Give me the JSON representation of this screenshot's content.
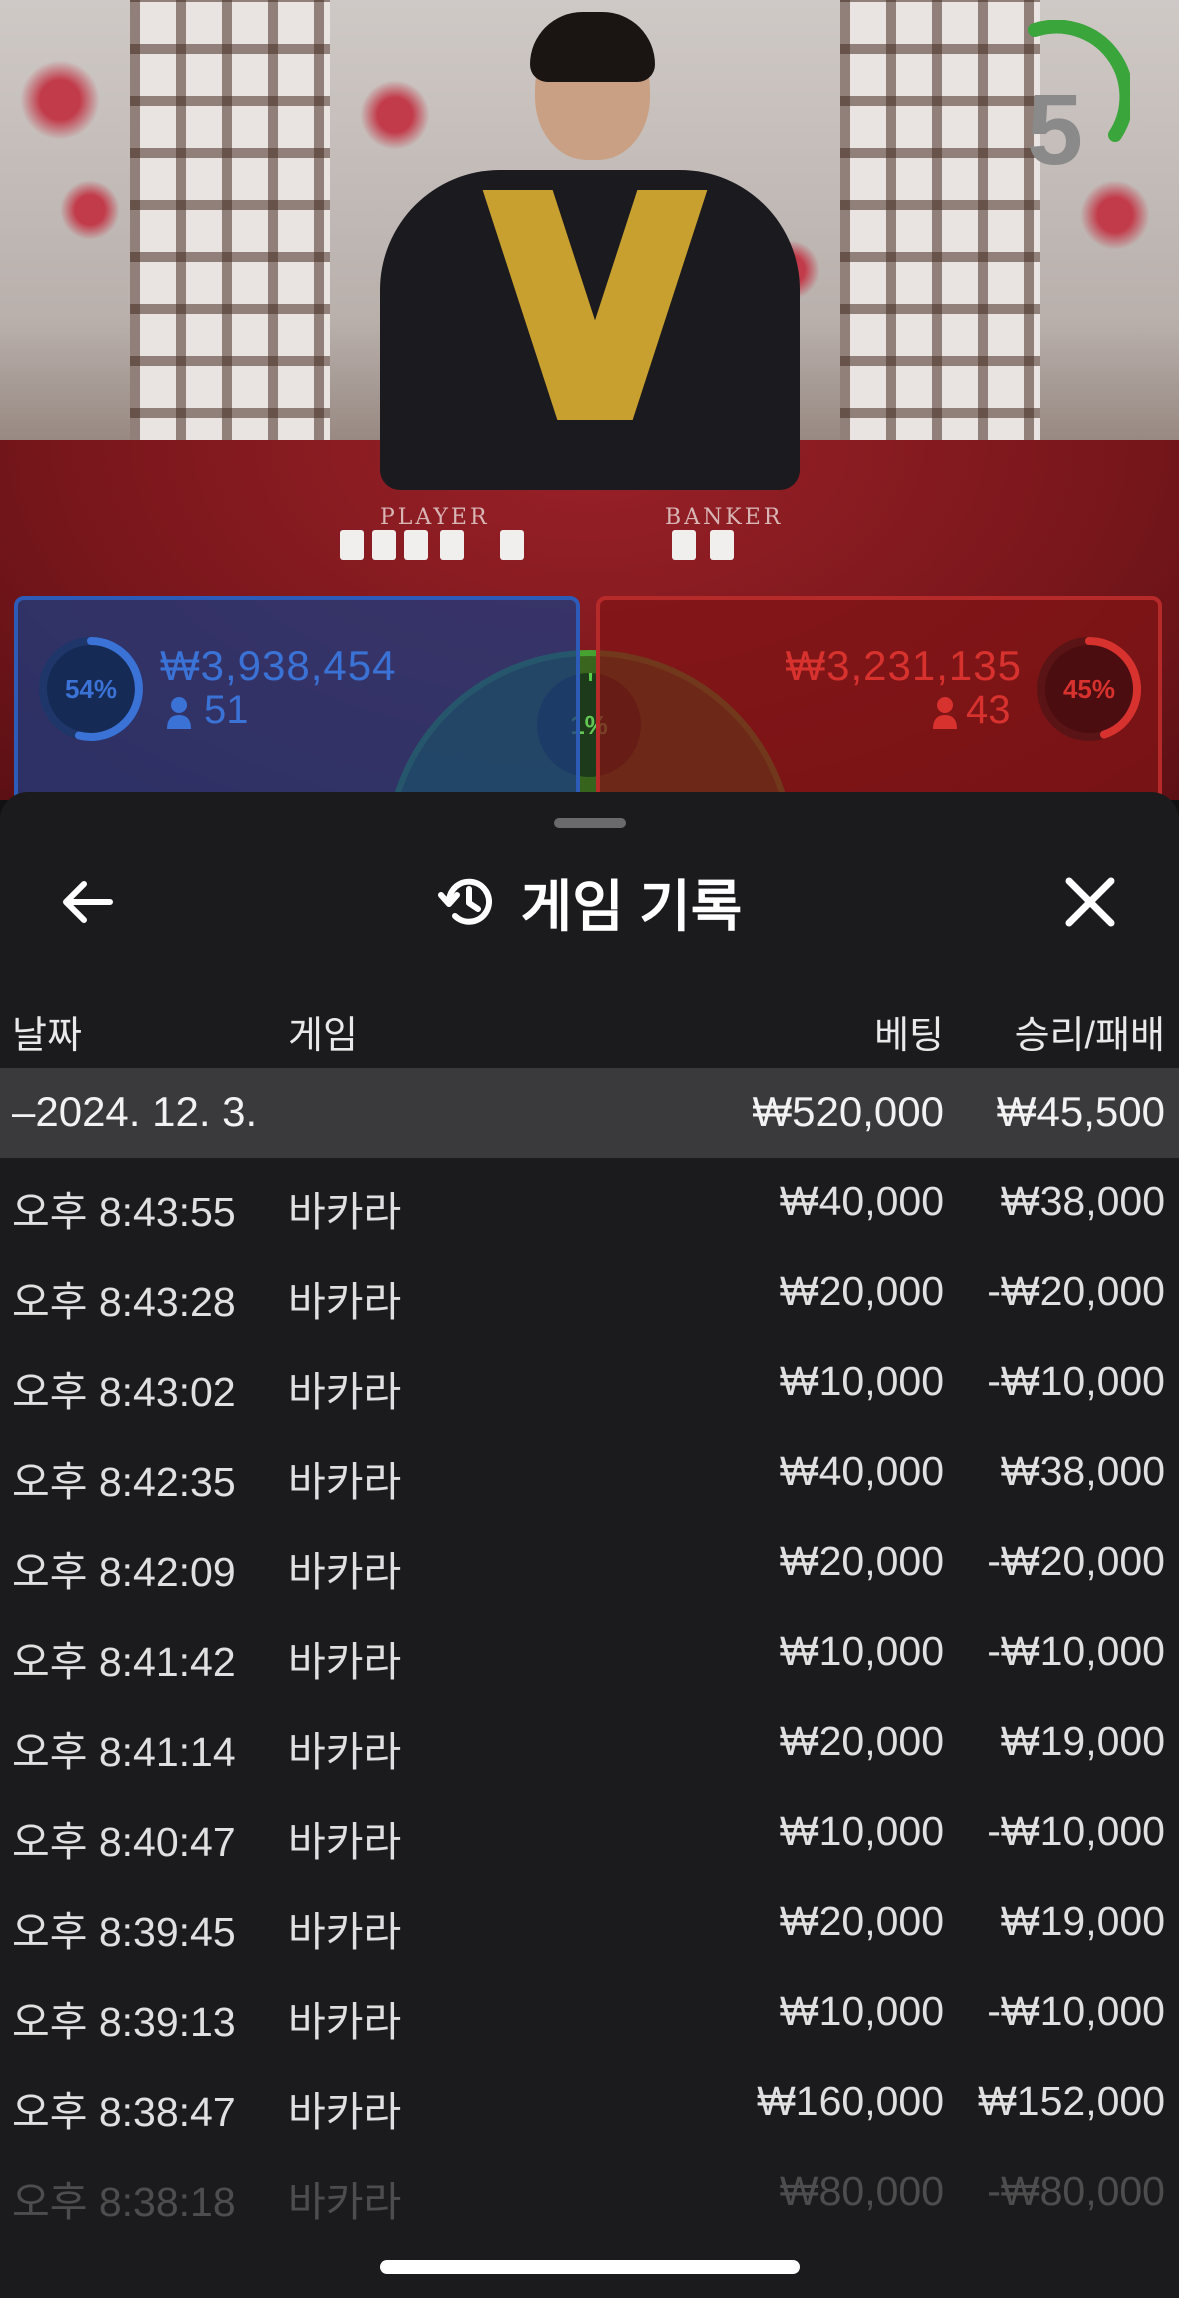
{
  "video": {
    "countdown": "5",
    "felt_labels": {
      "player": "PLAYER",
      "banker": "BANKER"
    }
  },
  "betting": {
    "player": {
      "percent": "54%",
      "amount": "₩3,938,454",
      "players": "51",
      "color": "#2d5bb8"
    },
    "tie": {
      "percent": "1%",
      "color": "#46a332"
    },
    "banker": {
      "percent": "45%",
      "amount": "₩3,231,135",
      "players": "43",
      "color": "#b72a2a"
    }
  },
  "sheet": {
    "title": "게임 기록",
    "back_icon": "arrow-left-icon",
    "history_icon": "history-icon",
    "close_icon": "close-icon",
    "columns": {
      "date": "날짜",
      "game": "게임",
      "bet": "베팅",
      "result": "승리/패배"
    },
    "group": {
      "date": "–2024. 12. 3.",
      "bet": "₩520,000",
      "result": "₩45,500"
    },
    "rows": [
      {
        "time": "오후 8:43:55",
        "game": "바카라",
        "bet": "₩40,000",
        "result": "₩38,000"
      },
      {
        "time": "오후 8:43:28",
        "game": "바카라",
        "bet": "₩20,000",
        "result": "-₩20,000"
      },
      {
        "time": "오후 8:43:02",
        "game": "바카라",
        "bet": "₩10,000",
        "result": "-₩10,000"
      },
      {
        "time": "오후 8:42:35",
        "game": "바카라",
        "bet": "₩40,000",
        "result": "₩38,000"
      },
      {
        "time": "오후 8:42:09",
        "game": "바카라",
        "bet": "₩20,000",
        "result": "-₩20,000"
      },
      {
        "time": "오후 8:41:42",
        "game": "바카라",
        "bet": "₩10,000",
        "result": "-₩10,000"
      },
      {
        "time": "오후 8:41:14",
        "game": "바카라",
        "bet": "₩20,000",
        "result": "₩19,000"
      },
      {
        "time": "오후 8:40:47",
        "game": "바카라",
        "bet": "₩10,000",
        "result": "-₩10,000"
      },
      {
        "time": "오후 8:39:45",
        "game": "바카라",
        "bet": "₩20,000",
        "result": "₩19,000"
      },
      {
        "time": "오후 8:39:13",
        "game": "바카라",
        "bet": "₩10,000",
        "result": "-₩10,000"
      },
      {
        "time": "오후 8:38:47",
        "game": "바카라",
        "bet": "₩160,000",
        "result": "₩152,000"
      },
      {
        "time": "오후 8:38:18",
        "game": "바카라",
        "bet": "₩80,000",
        "result": "-₩80,000"
      }
    ]
  }
}
